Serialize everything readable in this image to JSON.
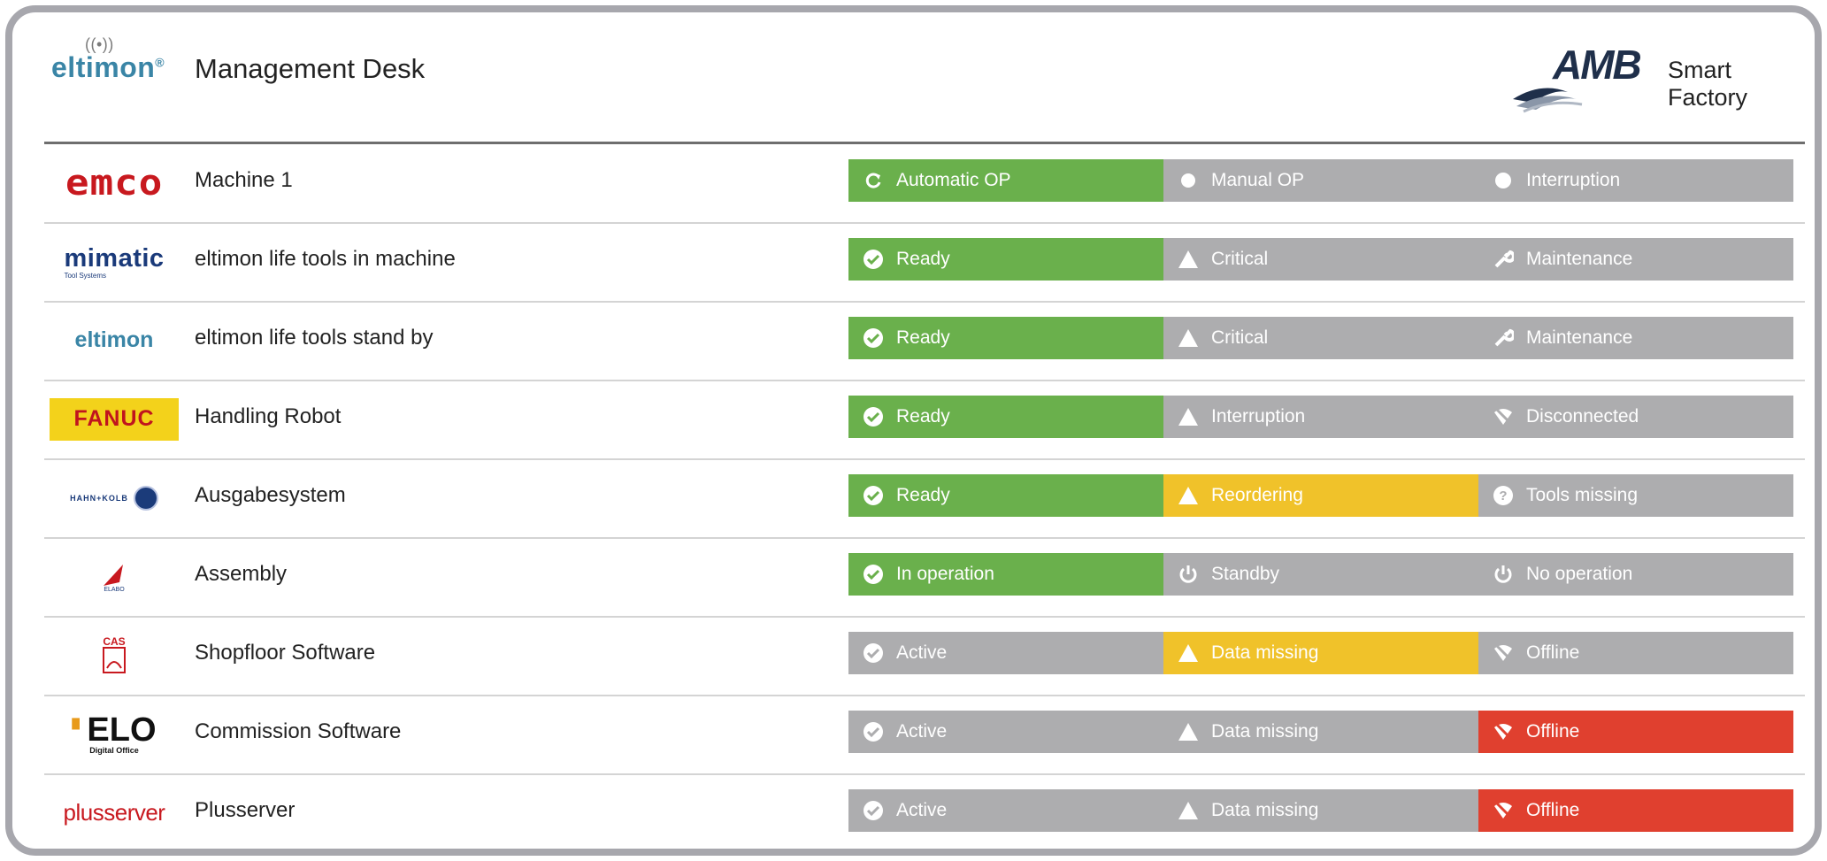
{
  "header": {
    "brand": "eltimon",
    "brand_mark": "®",
    "title": "Management Desk",
    "partner_logo": "AMB",
    "partner_text": "Smart Factory"
  },
  "colors": {
    "green": "#6ab04c",
    "grey": "#adadaf",
    "yellow": "#f0c22a",
    "red": "#e0402f"
  },
  "rows": [
    {
      "logo": "emco",
      "name": "Machine 1",
      "statuses": [
        {
          "label": "Automatic OP",
          "icon": "refresh-icon",
          "color": "green"
        },
        {
          "label": "Manual OP",
          "icon": "dot-icon",
          "color": "grey"
        },
        {
          "label": "Interruption",
          "icon": "dot-icon",
          "color": "grey"
        }
      ]
    },
    {
      "logo": "mimatic",
      "logo_sub": "Tool Systems",
      "name": "eltimon life tools in machine",
      "statuses": [
        {
          "label": "Ready",
          "icon": "check-circle-icon",
          "color": "green"
        },
        {
          "label": "Critical",
          "icon": "warning-icon",
          "color": "grey"
        },
        {
          "label": "Maintenance",
          "icon": "wrench-icon",
          "color": "grey"
        }
      ]
    },
    {
      "logo": "eltimon",
      "name": "eltimon life tools stand by",
      "statuses": [
        {
          "label": "Ready",
          "icon": "check-circle-icon",
          "color": "green"
        },
        {
          "label": "Critical",
          "icon": "warning-icon",
          "color": "grey"
        },
        {
          "label": "Maintenance",
          "icon": "wrench-icon",
          "color": "grey"
        }
      ]
    },
    {
      "logo": "FANUC",
      "name": "Handling Robot",
      "statuses": [
        {
          "label": "Ready",
          "icon": "check-circle-icon",
          "color": "green"
        },
        {
          "label": "Interruption",
          "icon": "warning-icon",
          "color": "grey"
        },
        {
          "label": "Disconnected",
          "icon": "wifi-off-icon",
          "color": "grey"
        }
      ]
    },
    {
      "logo": "HAHN+KOLB",
      "name": "Ausgabesystem",
      "statuses": [
        {
          "label": "Ready",
          "icon": "check-circle-icon",
          "color": "green"
        },
        {
          "label": "Reordering",
          "icon": "warning-icon",
          "color": "yellow"
        },
        {
          "label": "Tools missing",
          "icon": "question-circle-icon",
          "color": "grey"
        }
      ]
    },
    {
      "logo": "ELABO",
      "name": "Assembly",
      "statuses": [
        {
          "label": "In operation",
          "icon": "check-circle-icon",
          "color": "green"
        },
        {
          "label": "Standby",
          "icon": "power-icon",
          "color": "grey"
        },
        {
          "label": "No operation",
          "icon": "power-icon",
          "color": "grey"
        }
      ]
    },
    {
      "logo": "CAS",
      "name": "Shopfloor Software",
      "statuses": [
        {
          "label": "Active",
          "icon": "check-circle-icon",
          "color": "grey"
        },
        {
          "label": "Data missing",
          "icon": "warning-icon",
          "color": "yellow"
        },
        {
          "label": "Offline",
          "icon": "wifi-off-icon",
          "color": "grey"
        }
      ]
    },
    {
      "logo": "ELO",
      "logo_sub": "Digital Office",
      "name": "Commission Software",
      "statuses": [
        {
          "label": "Active",
          "icon": "check-circle-icon",
          "color": "grey"
        },
        {
          "label": "Data missing",
          "icon": "warning-icon",
          "color": "grey"
        },
        {
          "label": "Offline",
          "icon": "wifi-off-icon",
          "color": "red"
        }
      ]
    },
    {
      "logo": "plusserver",
      "name": "Plusserver",
      "statuses": [
        {
          "label": "Active",
          "icon": "check-circle-icon",
          "color": "grey"
        },
        {
          "label": "Data missing",
          "icon": "warning-icon",
          "color": "grey"
        },
        {
          "label": "Offline",
          "icon": "wifi-off-icon",
          "color": "red"
        }
      ]
    }
  ]
}
